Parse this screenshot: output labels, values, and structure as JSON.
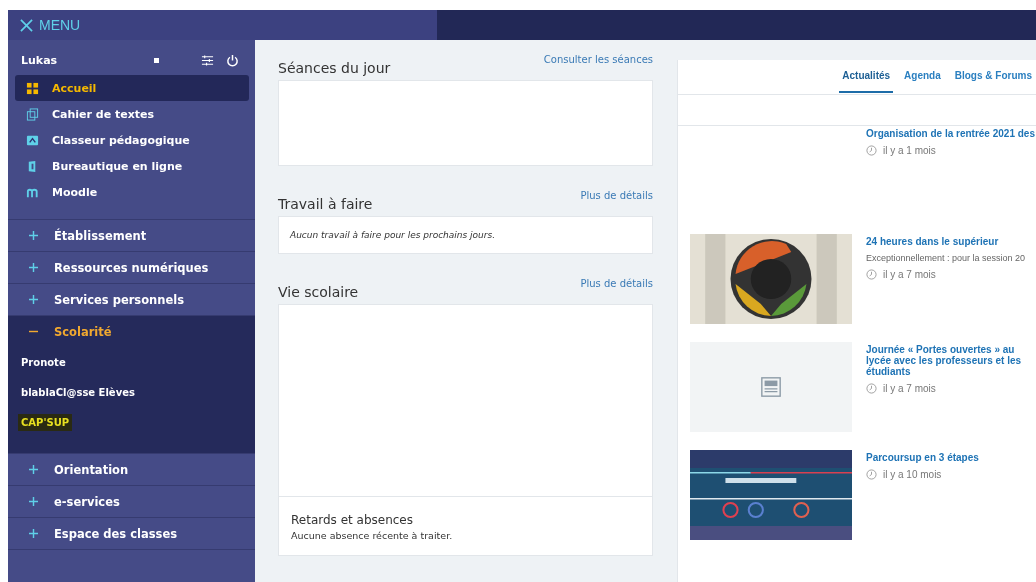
{
  "top_bar": {
    "menu_label": "MENU"
  },
  "user": {
    "name": "Lukas"
  },
  "apps": [
    {
      "label": "Accueil",
      "selected": true
    },
    {
      "label": "Cahier de textes",
      "selected": false
    },
    {
      "label": "Classeur pédagogique",
      "selected": false
    },
    {
      "label": "Bureautique en ligne",
      "selected": false
    },
    {
      "label": "Moodle",
      "selected": false
    }
  ],
  "sections": [
    {
      "label": "Établissement",
      "expanded": false
    },
    {
      "label": "Ressources numériques",
      "expanded": false
    },
    {
      "label": "Services personnels",
      "expanded": false
    },
    {
      "label": "Scolarité",
      "expanded": true,
      "children": [
        {
          "label": "Pronote",
          "highlighted": false
        },
        {
          "label": "blablaCl@sse Elèves",
          "highlighted": false
        },
        {
          "label": "CAP'SUP",
          "highlighted": true
        }
      ]
    },
    {
      "label": "Orientation",
      "expanded": false
    },
    {
      "label": "e-services",
      "expanded": false
    },
    {
      "label": "Espace des classes",
      "expanded": false
    }
  ],
  "widgets": [
    {
      "title": "Séances du jour",
      "link": "Consulter les séances",
      "kind": "empty"
    },
    {
      "title": "Travail à faire",
      "link": "Plus de détails",
      "kind": "message",
      "message": "Aucun travail à faire pour les prochains jours."
    },
    {
      "title": "Vie scolaire",
      "link": "Plus de détails",
      "kind": "absences",
      "subtitle": "Retards et absences",
      "message": "Aucune absence récente à traiter."
    }
  ],
  "news_tabs": [
    {
      "label": "Actualités",
      "selected": true
    },
    {
      "label": "Agenda",
      "selected": false
    },
    {
      "label": "Blogs & Forums",
      "selected": false
    }
  ],
  "news": [
    {
      "title": "Organisation de la rentrée 2021 des",
      "time": "il y a 1 mois"
    },
    {
      "title": "24 heures dans le supérieur",
      "summary": "Exceptionnellement : pour la session 20",
      "time": "il y a 7 mois",
      "kind": "picture"
    },
    {
      "title": "Journée « Portes ouvertes » au lycée avec les professeurs et les étudiants",
      "time": "il y a 7 mois",
      "kind": "placeholder"
    },
    {
      "title": "Parcoursup en 3 étapes",
      "time": "il y a 10 mois",
      "kind": "picture"
    }
  ]
}
